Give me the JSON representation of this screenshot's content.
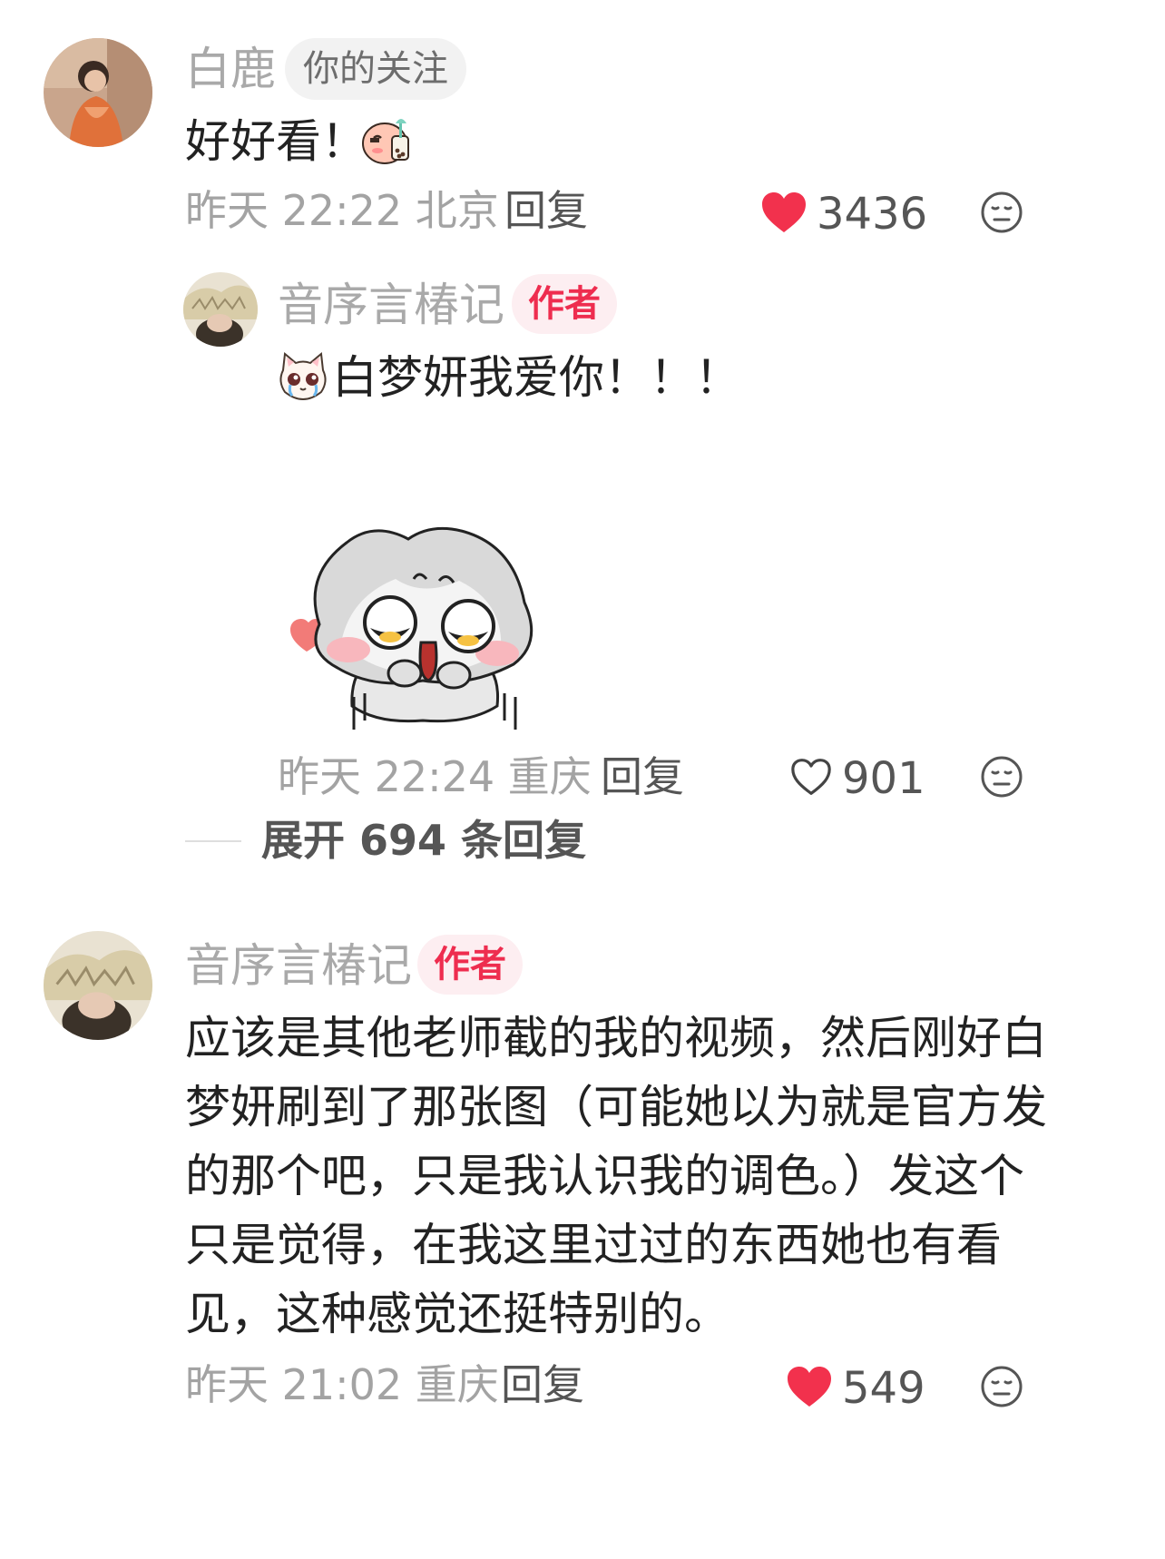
{
  "colors": {
    "like_active": "#f2314d",
    "author_tag_text": "#ee2d4f",
    "author_tag_bg": "#fdeef1",
    "follow_tag_bg": "#f2f2f2",
    "meta_text": "#a3a3a3",
    "body_text": "#222222"
  },
  "comments": [
    {
      "author": "白鹿",
      "tag": "你的关注",
      "text": "好好看！",
      "sticker_icon": "peach-milk-tea-emoji-icon",
      "time": "昨天 22:22 北京",
      "reply_label": "回复",
      "likes": "3436",
      "liked": true,
      "dislike_icon": "meh-face-icon",
      "replies": [
        {
          "author": "音序言椿记",
          "tag": "作者",
          "emoji_icon": "crying-cat-emoji-icon",
          "text": "白梦妍我爱你！！！",
          "sticker_icon": "crying-bunny-sticker-icon",
          "time": "昨天 22:24 重庆",
          "reply_label": "回复",
          "likes": "901",
          "liked": false,
          "dislike_icon": "meh-face-icon"
        }
      ],
      "expand_label": "展开 694 条回复"
    },
    {
      "author": "音序言椿记",
      "tag": "作者",
      "lines": [
        "应该是其他老师截的我的视频，然后刚好白",
        "梦妍刷到了那张图（可能她以为就是官方发",
        "的那个吧，只是我认识我的调色。）发这个",
        "只是觉得，在我这里过过的东西她也有看",
        "见，这种感觉还挺特别的。"
      ],
      "time": "昨天 21:02 重庆",
      "reply_label": "回复",
      "likes": "549",
      "liked": true,
      "dislike_icon": "meh-face-icon"
    }
  ]
}
